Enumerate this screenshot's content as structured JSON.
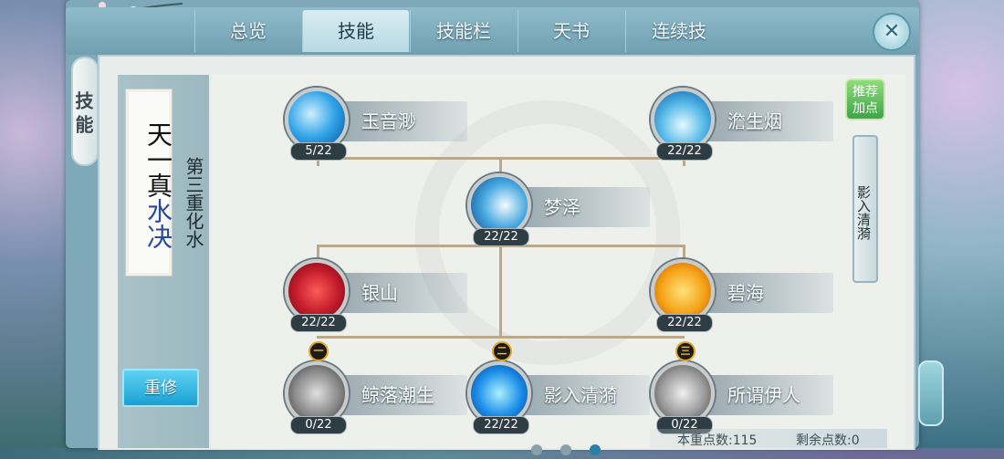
{
  "tabs": [
    {
      "label": "总览",
      "active": false
    },
    {
      "label": "技能",
      "active": true
    },
    {
      "label": "技能栏",
      "active": false
    },
    {
      "label": "天书",
      "active": false
    },
    {
      "label": "连续技",
      "active": false
    }
  ],
  "close_label": "✕",
  "side_tab": "技能",
  "scroll_title": {
    "line1": "天一真",
    "line2": "水决"
  },
  "realm_title": "第三重化水",
  "reset_button": "重修",
  "prev_arrow": "❮",
  "recommend_button": "推荐加点",
  "scroll_skill_name": "影入清漪",
  "skills": [
    {
      "name": "玉音渺",
      "level": "5/22",
      "icon": "water-swirl-icon"
    },
    {
      "name": "澹生烟",
      "level": "22/22",
      "icon": "cloud-figure-icon"
    },
    {
      "name": "梦泽",
      "level": "22/22",
      "icon": "dream-wave-icon"
    },
    {
      "name": "银山",
      "level": "22/22",
      "icon": "red-shield-icon"
    },
    {
      "name": "碧海",
      "level": "22/22",
      "icon": "gold-shield-icon"
    },
    {
      "name": "鲸落潮生",
      "level": "0/22",
      "icon": "whale-wind-icon"
    },
    {
      "name": "影入清漪",
      "level": "22/22",
      "icon": "shadow-water-icon"
    },
    {
      "name": "所谓伊人",
      "level": "0/22",
      "icon": "silver-swirl-icon"
    }
  ],
  "badges": [
    "一",
    "二",
    "三"
  ],
  "points": {
    "current_label": "本重点数:115",
    "remaining_label": "剩余点数:0"
  },
  "colors": {
    "accent": "#1aa0d4",
    "line": "#b9a98a",
    "tab_active": "#c9e4ec"
  }
}
